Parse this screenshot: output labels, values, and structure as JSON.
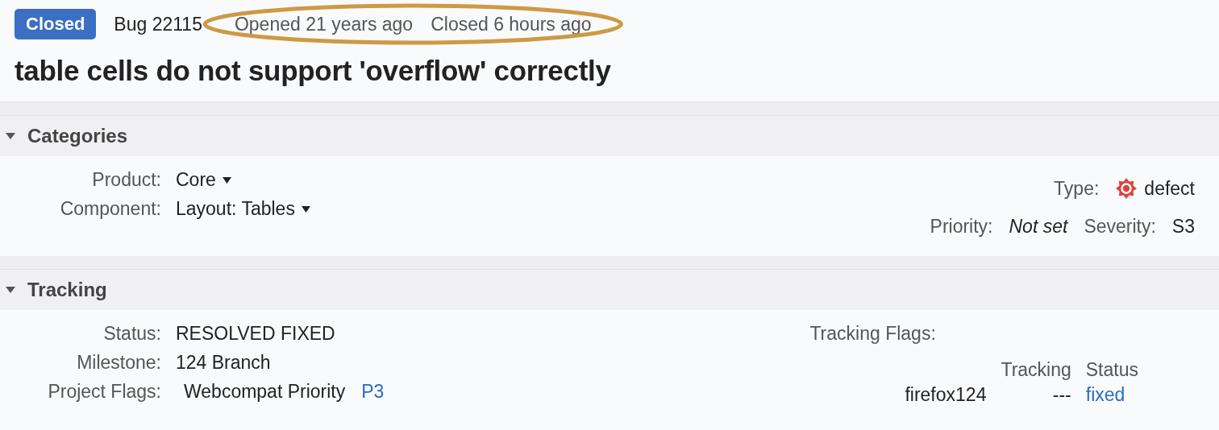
{
  "header": {
    "status_badge": "Closed",
    "bug_id": "Bug 22115",
    "opened": "Opened 21 years ago",
    "closed": "Closed 6 hours ago",
    "title": "table cells do not support 'overflow' correctly"
  },
  "categories": {
    "heading": "Categories",
    "expanded": true,
    "fields": [
      {
        "label": "Product:",
        "value": "Core",
        "kind": "dropdown"
      },
      {
        "label": "Component:",
        "value": "Layout: Tables",
        "kind": "dropdown"
      }
    ],
    "type": {
      "label": "Type:",
      "value": "defect"
    },
    "priority": {
      "label": "Priority:",
      "value": "Not set"
    },
    "severity": {
      "label": "Severity:",
      "value": "S3"
    }
  },
  "tracking": {
    "heading": "Tracking",
    "expanded": true,
    "fields": [
      {
        "label": "Status:",
        "value": "RESOLVED FIXED",
        "kind": "text"
      },
      {
        "label": "Milestone:",
        "value": "124 Branch",
        "kind": "text"
      },
      {
        "label": "Project Flags:",
        "value": "Webcompat Priority",
        "link": "P3",
        "kind": "flag"
      }
    ],
    "tracking_flags": {
      "label": "Tracking Flags:",
      "columns": [
        "Tracking",
        "Status"
      ],
      "rows": [
        {
          "name": "firefox124",
          "tracking": "---",
          "status": "fixed"
        }
      ]
    }
  }
}
